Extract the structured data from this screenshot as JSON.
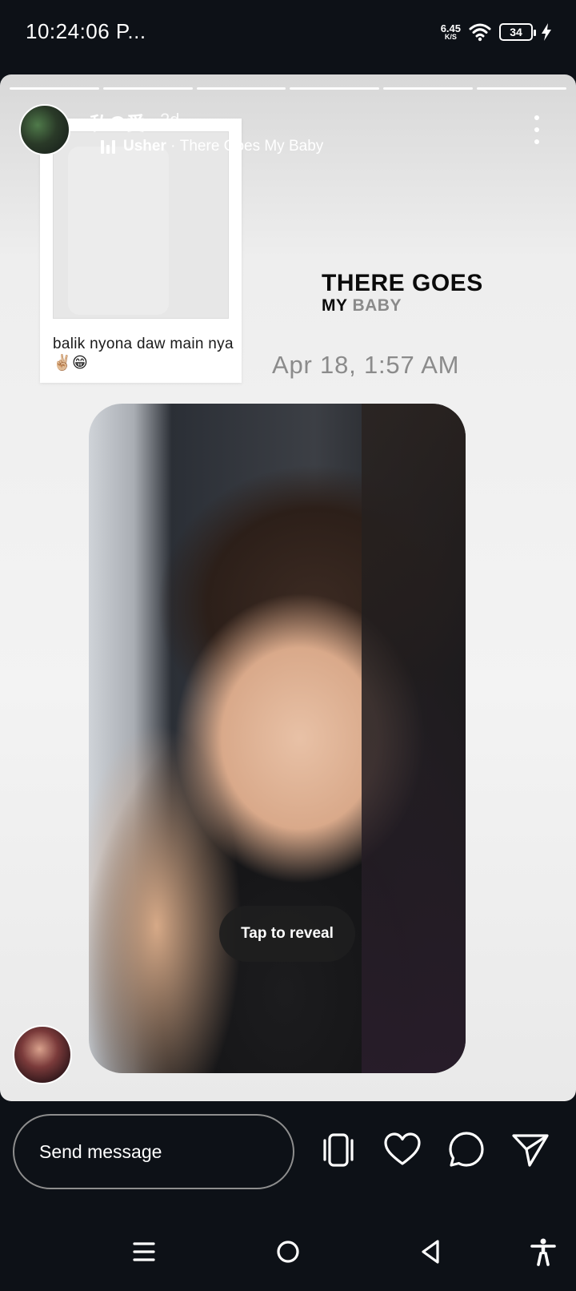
{
  "status_bar": {
    "time": "10:24:06 P...",
    "net_speed_value": "6.45",
    "net_speed_unit": "K/S",
    "battery": "34"
  },
  "story": {
    "progress_segments": 6,
    "user_name": "私の愛",
    "post_age": "2d",
    "music_artist": "Usher",
    "music_separator": " · ",
    "music_title": "There Goes My Baby",
    "song_sticker_line1": "THERE GOES",
    "song_sticker_line2_a": "MY",
    "song_sticker_line2_b": "BABY",
    "polaroid_caption": "balik nyona daw main nya✌🏼😁",
    "date_stamp": "Apr 18, 1:57 AM",
    "tap_to_reveal": "Tap to reveal"
  },
  "action_bar": {
    "send_message_placeholder": "Send message"
  },
  "icons": {
    "more": "more-vert-icon",
    "music": "music-bars-icon",
    "phone_vibrate": "phone-vibrate-icon",
    "like": "heart-icon",
    "comment": "comment-icon",
    "share": "send-icon",
    "menu": "menu-icon",
    "home": "home-circle-icon",
    "back": "back-triangle-icon",
    "accessibility": "accessibility-icon"
  },
  "colors": {
    "background": "#0d1117",
    "story_bg": "#f3f3f3",
    "date_text": "#8b8b8b"
  }
}
